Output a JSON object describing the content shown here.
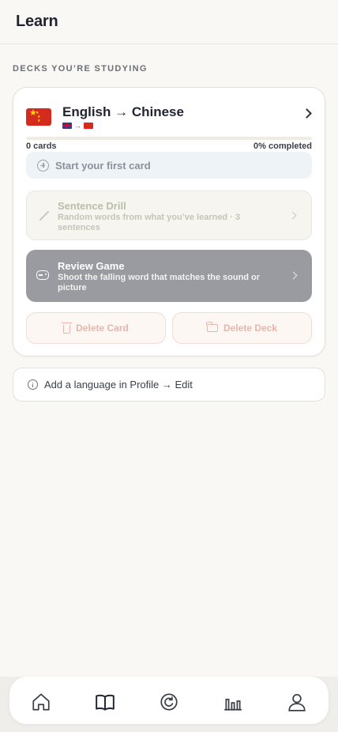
{
  "header": {
    "title": "Learn"
  },
  "section": {
    "label": "DECKS YOU’RE STUDYING"
  },
  "deck": {
    "title": "English → Chinese",
    "from_flag": "uk-flag",
    "to_flag": "china-flag",
    "arrow": "→",
    "cards_label": "0 cards",
    "completed_label": "0% completed",
    "progress": 0,
    "start_label": "Start your first card",
    "sentence_drill": {
      "title": "Sentence Drill",
      "description": "Random words from what you’ve learned · 3 sentences"
    },
    "review_game": {
      "title": "Review Game",
      "description": "Shoot the falling word that matches the sound or picture"
    },
    "delete_card_label": "Delete Card",
    "delete_deck_label": "Delete Deck"
  },
  "add_language": {
    "label": "Add a language in Profile → Edit"
  },
  "tabbar": {
    "items": [
      {
        "icon": "home-icon"
      },
      {
        "icon": "book-icon"
      },
      {
        "icon": "review-icon"
      },
      {
        "icon": "stats-icon"
      },
      {
        "icon": "profile-icon"
      }
    ]
  },
  "colors": {
    "background": "#faf8f4",
    "review_button": "#9a9ba0",
    "danger_text": "#e9b4ab",
    "start_card_bg": "#eef3f8"
  }
}
